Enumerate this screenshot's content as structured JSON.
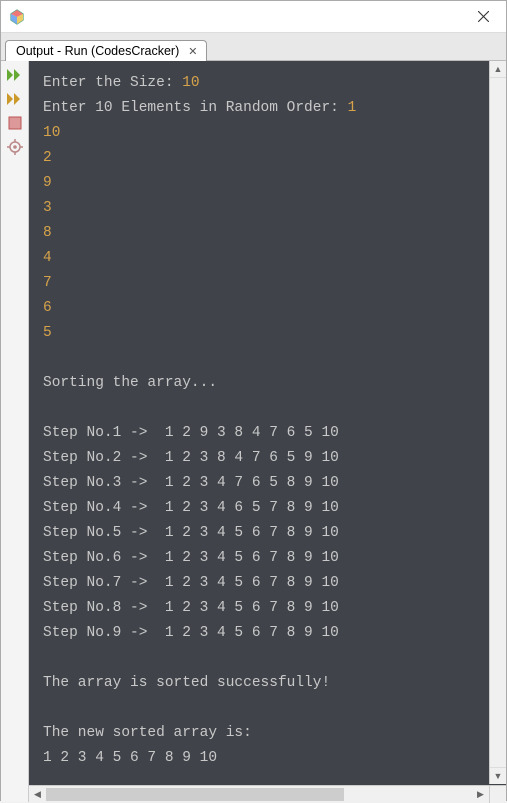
{
  "titlebar": {
    "title": ""
  },
  "tab": {
    "label": "Output - Run (CodesCracker)"
  },
  "sidebar_icons": {
    "run": "run-double-icon",
    "run2": "run-double-yellow-icon",
    "stop": "stop-icon",
    "settings": "settings-icon"
  },
  "console": {
    "prompt_size": "Enter the Size: ",
    "size_val": "10",
    "prompt_elems": "Enter 10 Elements in Random Order: ",
    "inputs": [
      "1",
      "10",
      "2",
      "9",
      "3",
      "8",
      "4",
      "7",
      "6",
      "5"
    ],
    "sorting_msg": "Sorting the array...",
    "steps": [
      "Step No.1 ->  1 2 9 3 8 4 7 6 5 10",
      "Step No.2 ->  1 2 3 8 4 7 6 5 9 10",
      "Step No.3 ->  1 2 3 4 7 6 5 8 9 10",
      "Step No.4 ->  1 2 3 4 6 5 7 8 9 10",
      "Step No.5 ->  1 2 3 4 5 6 7 8 9 10",
      "Step No.6 ->  1 2 3 4 5 6 7 8 9 10",
      "Step No.7 ->  1 2 3 4 5 6 7 8 9 10",
      "Step No.8 ->  1 2 3 4 5 6 7 8 9 10",
      "Step No.9 ->  1 2 3 4 5 6 7 8 9 10"
    ],
    "success_msg": "The array is sorted successfully!",
    "new_array_label": "The new sorted array is:",
    "new_array": "1 2 3 4 5 6 7 8 9 10"
  }
}
